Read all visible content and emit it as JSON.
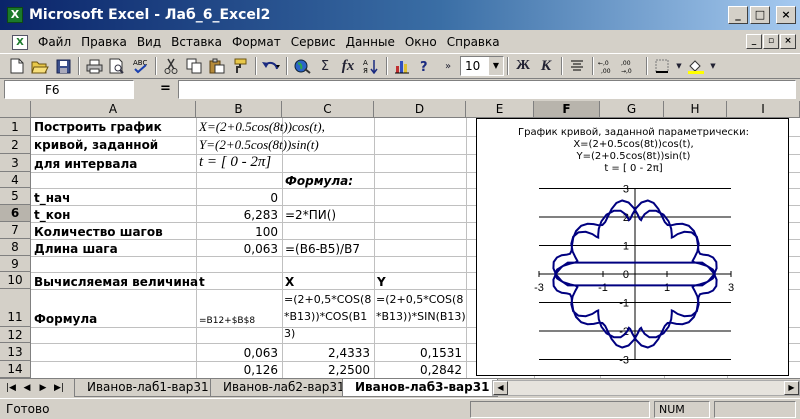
{
  "window": {
    "title": "Microsoft Excel - Лаб_6_Excel2",
    "app_icon": "excel-icon",
    "min_label": "_",
    "max_label": "□",
    "close_label": "×"
  },
  "menu": {
    "items": [
      "Файл",
      "Правка",
      "Вид",
      "Вставка",
      "Формат",
      "Сервис",
      "Данные",
      "Окно",
      "Справка"
    ],
    "mdi_min": "_",
    "mdi_restore": "▫",
    "mdi_close": "×"
  },
  "toolbar": {
    "font_size": "10",
    "bold_label": "Ж",
    "italic_label": "К",
    "sigma_label": "Σ",
    "fx_label": "fx"
  },
  "formula_bar": {
    "name_box": "F6",
    "equals": "="
  },
  "columns": [
    "A",
    "B",
    "C",
    "D",
    "E",
    "F",
    "G",
    "H",
    "I"
  ],
  "selected_column": "F",
  "rows": [
    "1",
    "2",
    "3",
    "4",
    "5",
    "6",
    "7",
    "8",
    "9",
    "10",
    "11",
    "12",
    "13",
    "14"
  ],
  "selected_row": "6",
  "cells": {
    "A1": "Построить график",
    "B1": "X=(2+0.5cos(8t))cos(t),",
    "A2": "кривой, заданной",
    "B2": "Y=(2+0.5cos(8t))sin(t)",
    "A3": "для интервала",
    "B3": "t = [ 0 - 2π]",
    "C4": "Формула:",
    "A5": "t_нач",
    "B5": "0",
    "A6": "t_кон",
    "B6": "6,283",
    "C6": "=2*ПИ()",
    "A7": "Количество шагов",
    "B7": "100",
    "A8": "Длина шага",
    "B8": "0,063",
    "C8": "=(B6-B5)/B7",
    "A10": "Вычисляемая величина",
    "B10": "t",
    "C10": "X",
    "D10": "Y",
    "A11": "Формула",
    "B11": "=B12+$B$8",
    "C11": "=(2+0,5*COS(8*B13))*COS(B13)",
    "D11": "=(2+0,5*COS(8*B13))*SIN(B13)",
    "B13": "0,063",
    "C13": "2,4333",
    "D13": "0,1531",
    "B14": "0,126",
    "C14": "2,2500",
    "D14": "0,2842"
  },
  "chart": {
    "title_lines": [
      "График кривой, заданной параметрически:",
      "X=(2+0.5cos(8t))cos(t),",
      "Y=(2+0.5cos(8t))sin(t)",
      "t = [ 0 - 2π]"
    ],
    "x_tick_labels": [
      "-3",
      "-1",
      "1",
      "3"
    ],
    "y_tick_labels": [
      "3",
      "2",
      "1",
      "0",
      "-1",
      "-2",
      "-3"
    ]
  },
  "chart_data": {
    "type": "line",
    "title": "График кривой, заданной параметрически: X=(2+0.5cos(8t))cos(t), Y=(2+0.5cos(8t))sin(t) t = [ 0 - 2π]",
    "xlabel": "",
    "ylabel": "",
    "xlim": [
      -3,
      3
    ],
    "ylim": [
      -3,
      3
    ],
    "x_ticks": [
      -3,
      -1,
      1,
      3
    ],
    "y_ticks": [
      -3,
      -2,
      -1,
      0,
      1,
      2,
      3
    ],
    "grid_y": true,
    "series": [
      {
        "color": "#000080",
        "x": [
          2.5,
          2.4333,
          2.25,
          2.02,
          1.85,
          1.8,
          1.86,
          1.95,
          1.99,
          1.93,
          1.77,
          1.54,
          1.33,
          1.2,
          1.15,
          1.15,
          1.13,
          1.05,
          0.89,
          0.66,
          0.45,
          0.3,
          0.22,
          0.19,
          0.15,
          0.08,
          -0.03,
          -0.2,
          -0.4,
          -0.58,
          -0.73,
          -0.84,
          -0.93,
          -1.02,
          -1.13,
          -1.29,
          -1.48,
          -1.68,
          -1.84,
          -1.93,
          -1.97,
          -1.98,
          -2.03,
          -2.13,
          -2.29,
          -2.44,
          -2.54,
          -2.55,
          -2.46,
          -2.29,
          -2.1,
          -2.5
        ],
        "y": [
          0.0,
          0.1531,
          0.2842,
          0.37,
          0.41,
          0.46,
          0.58,
          0.79,
          1.06,
          1.31,
          1.46,
          1.48,
          1.4,
          1.3,
          1.28,
          1.38,
          1.59,
          1.85,
          2.08,
          2.22,
          2.22,
          2.1,
          1.96,
          1.89,
          1.93,
          2.09,
          2.31,
          2.51,
          2.58,
          2.49,
          2.28,
          2.03,
          1.82,
          1.72,
          1.71,
          1.75,
          1.76,
          1.69,
          1.51,
          1.27,
          1.01,
          0.82,
          0.71,
          0.68,
          0.66,
          0.58,
          0.42,
          0.2,
          -0.03,
          -0.25,
          -0.4,
          0.0
        ]
      }
    ]
  },
  "sheets": {
    "tabs": [
      "Иванов-лаб1-вар31",
      "Иванов-лаб2-вар31",
      "Иванов-лаб3-вар31"
    ],
    "active": "Иванов-лаб3-вар31"
  },
  "status": {
    "text": "Готово",
    "num": "NUM"
  }
}
